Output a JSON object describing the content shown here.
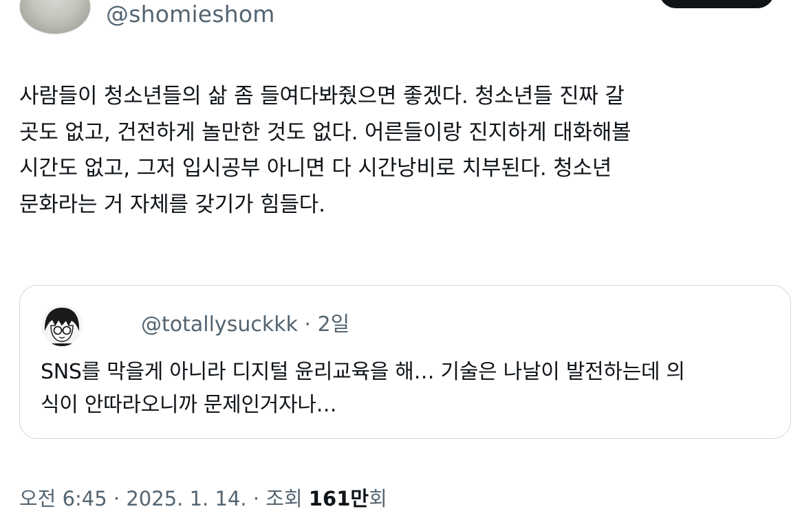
{
  "author": {
    "handle": "@shomieshom"
  },
  "tweet": {
    "lines": [
      "사람들이 청소년들의 삶 좀 들여다봐줬으면 좋겠다. 청소년들 진짜 갈",
      "곳도 없고, 건전하게 놀만한 것도 없다. 어른들이랑 진지하게 대화해볼",
      "시간도 없고, 그저 입시공부 아니면 다 시간낭비로 치부된다. 청소년",
      "문화라는 거 자체를 갖기가 힘들다."
    ]
  },
  "quote": {
    "handle": "@totallysuckkk",
    "separator": "·",
    "time": "2일",
    "lines": [
      "SNS를 막을게 아니라 디지털 윤리교육을 해… 기술은 나날이 발전하는데 의",
      "식이 안따라오니까 문제인거자나…"
    ]
  },
  "meta": {
    "time": "오전 6:45",
    "sep1": "·",
    "date": "2025. 1. 14.",
    "sep2": "·",
    "views_label": "조회",
    "views_count": "161만",
    "views_suffix": "회"
  },
  "colors": {
    "text": "#0f1419",
    "secondary": "#536471",
    "border": "#cfd9de"
  }
}
